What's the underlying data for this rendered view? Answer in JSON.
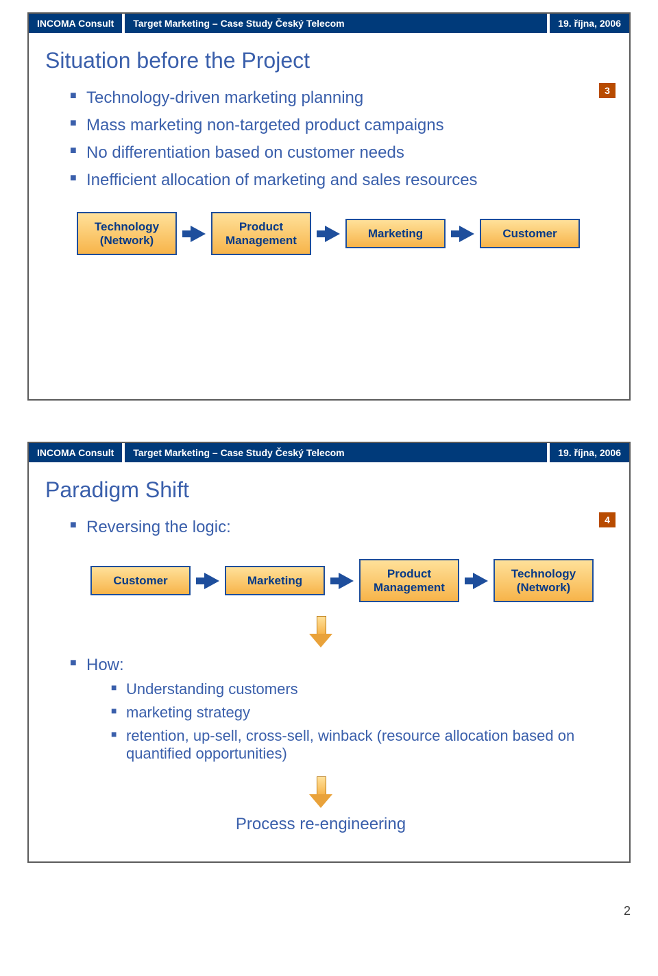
{
  "header": {
    "left": "INCOMA Consult",
    "mid": "Target Marketing – Case Study Český Telecom",
    "right": "19. října, 2006"
  },
  "slide1": {
    "title": "Situation before the Project",
    "page": "3",
    "bullets": [
      "Technology-driven marketing planning",
      "Mass marketing non-targeted product campaigns",
      "No differentiation based on customer needs",
      "Inefficient allocation of marketing and sales resources"
    ],
    "flow": [
      "Technology\n(Network)",
      "Product\nManagement",
      "Marketing",
      "Customer"
    ]
  },
  "slide2": {
    "title": "Paradigm Shift",
    "page": "4",
    "bullet_top": "Reversing the logic:",
    "flow": [
      "Customer",
      "Marketing",
      "Product\nManagement",
      "Technology\n(Network)"
    ],
    "how_label": "How:",
    "how_items": [
      "Understanding customers",
      "marketing strategy",
      "retention, up-sell, cross-sell, winback (resource allocation based on quantified opportunities)"
    ],
    "process": "Process re-engineering"
  },
  "pagenum": "2"
}
